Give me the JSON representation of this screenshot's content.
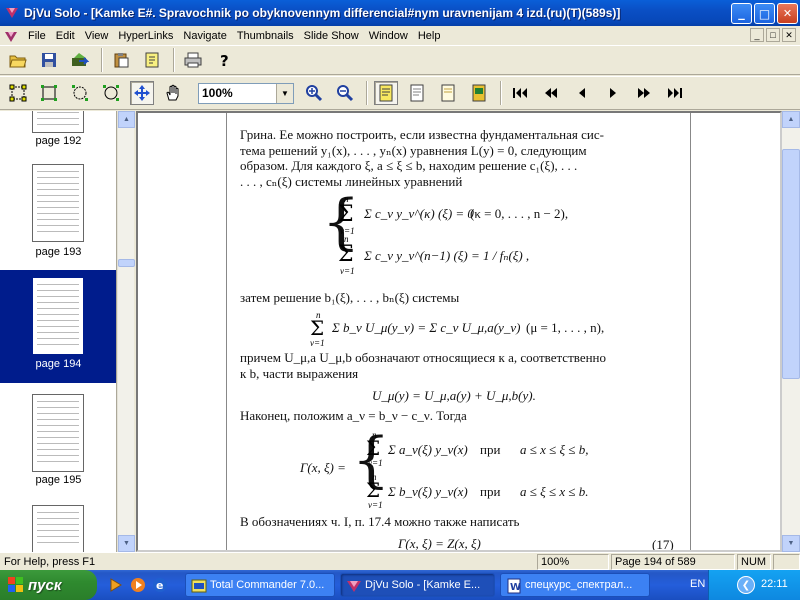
{
  "window": {
    "title": "DjVu Solo - [Kamke E#. Spravochnik po obyknovennym differencial#nym uravnenijam 4 izd.(ru)(T)(589s)]",
    "minimize": "_",
    "maximize": "□",
    "close": "✕"
  },
  "menu": [
    "File",
    "Edit",
    "View",
    "HyperLinks",
    "Navigate",
    "Thumbnails",
    "Slide Show",
    "Window",
    "Help"
  ],
  "mdi_buttons": [
    "_",
    "□",
    "✕"
  ],
  "toolbar": {
    "zoom_value": "100%",
    "icons": [
      "open-icon",
      "save-icon",
      "export-icon",
      "paste-icon",
      "insert-page-icon",
      "print-icon",
      "help-icon",
      "select-icon",
      "rect-select-icon",
      "lasso-icon",
      "zoom-region-icon",
      "move-icon",
      "hand-icon",
      "zoom-in-icon",
      "zoom-out-icon",
      "page-view-icon",
      "page-gray-icon",
      "page-light-icon",
      "page-color-icon",
      "first-page-icon",
      "prev-fast-icon",
      "prev-page-icon",
      "next-page-icon",
      "next-fast-icon",
      "last-page-icon"
    ]
  },
  "thumbnails": [
    {
      "label": "page 192",
      "selected": false
    },
    {
      "label": "page 193",
      "selected": false
    },
    {
      "label": "page 194",
      "selected": true
    },
    {
      "label": "page 195",
      "selected": false
    }
  ],
  "document": {
    "line1": "Грина. Ее можно построить, если известна фундаментальная сис-",
    "line2": "тема решений y₁(x), . . . , yₙ(x) уравнения L(y) = 0, следующим",
    "line3": "образом. Для каждого ξ, a ≤ ξ ≤ b, находим решение c₁(ξ), . . .",
    "line4": ". . . , cₙ(ξ) системы линейных уравнений",
    "sys1a": "Σ c_ν y_ν^(κ) (ξ) = 0",
    "sys1a_cond": "(κ = 0, . . . , n − 2),",
    "sys1b": "Σ c_ν y_ν^(n−1) (ξ) = 1 / fₙ(ξ) ,",
    "line5": "затем решение b₁(ξ), . . . , bₙ(ξ) системы",
    "eq2": "Σ b_ν U_μ(y_ν) = Σ c_ν U_μ,a(y_ν)",
    "eq2_cond": "(μ = 1, . . . , n),",
    "line6": "причем U_μ,a U_μ,b обозначают относящиеся к a, соответственно",
    "line7": "к b, части выражения",
    "eq3": "U_μ(y) = U_μ,a(y) + U_μ,b(y).",
    "line8": "Наконец, положим a_ν = b_ν − c_ν. Тогда",
    "gamma": "Γ(x, ξ) =",
    "g1": "Σ a_ν(ξ) y_ν(x)",
    "g1_when": "при",
    "g1_cond": "a ≤ x ≤ ξ ≤ b,",
    "g2": "Σ b_ν(ξ) y_ν(x)",
    "g2_when": "при",
    "g2_cond": "a ≤ ξ ≤ x ≤ b.",
    "line9": "В обозначениях ч. I, п. 17.4 можно также написать",
    "eq4": "Γ(x, ξ) = Z(x, ξ)",
    "eq4_num": "(17)",
    "sum_top": "n",
    "sum_bottom": "ν=1"
  },
  "status": {
    "help": "For Help, press F1",
    "zoom": "100%",
    "page": "Page 194 of 589",
    "num": "NUM"
  },
  "taskbar": {
    "start": "пуск",
    "tasks": [
      {
        "label": "Total Commander 7.0...",
        "active": false
      },
      {
        "label": "DjVu Solo - [Kamke E...",
        "active": true
      },
      {
        "label": "спецкурс_спектрал...",
        "active": false
      }
    ],
    "lang": "EN",
    "clock": "22:11"
  }
}
